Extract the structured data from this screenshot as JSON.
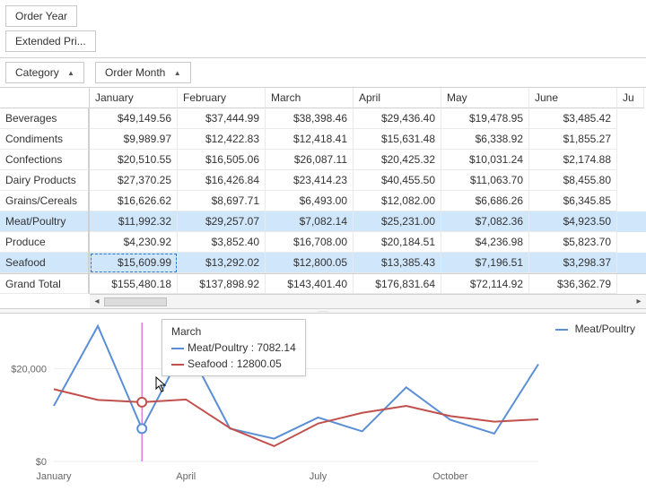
{
  "fields": {
    "order_year": "Order Year",
    "extended_price": "Extended Pri...",
    "category": "Category",
    "order_month": "Order Month"
  },
  "columns": [
    "January",
    "February",
    "March",
    "April",
    "May",
    "June",
    "Ju"
  ],
  "rows": [
    "Beverages",
    "Condiments",
    "Confections",
    "Dairy Products",
    "Grains/Cereals",
    "Meat/Poultry",
    "Produce",
    "Seafood"
  ],
  "grand_total_label": "Grand Total",
  "data": [
    [
      "$49,149.56",
      "$37,444.99",
      "$38,398.46",
      "$29,436.40",
      "$19,478.95",
      "$3,485.42"
    ],
    [
      "$9,989.97",
      "$12,422.83",
      "$12,418.41",
      "$15,631.48",
      "$6,338.92",
      "$1,855.27"
    ],
    [
      "$20,510.55",
      "$16,505.06",
      "$26,087.11",
      "$20,425.32",
      "$10,031.24",
      "$2,174.88"
    ],
    [
      "$27,370.25",
      "$16,426.84",
      "$23,414.23",
      "$40,455.50",
      "$11,063.70",
      "$8,455.80"
    ],
    [
      "$16,626.62",
      "$8,697.71",
      "$6,493.00",
      "$12,082.00",
      "$6,686.26",
      "$6,345.85"
    ],
    [
      "$11,992.32",
      "$29,257.07",
      "$7,082.14",
      "$25,231.00",
      "$7,082.36",
      "$4,923.50"
    ],
    [
      "$4,230.92",
      "$3,852.40",
      "$16,708.00",
      "$20,184.51",
      "$4,236.98",
      "$5,823.70"
    ],
    [
      "$15,609.99",
      "$13,292.02",
      "$12,800.05",
      "$13,385.43",
      "$7,196.51",
      "$3,298.37"
    ]
  ],
  "grand_total": [
    "$155,480.18",
    "$137,898.92",
    "$143,401.40",
    "$176,831.64",
    "$72,114.92",
    "$36,362.79"
  ],
  "selected_rows": [
    5,
    7
  ],
  "focused_cell": {
    "row": 7,
    "col": 0
  },
  "chart_data": {
    "type": "line",
    "x": [
      "January",
      "February",
      "March",
      "April",
      "May",
      "June",
      "July",
      "August",
      "September",
      "October",
      "November",
      "December"
    ],
    "x_ticks_shown": [
      "January",
      "April",
      "July",
      "October"
    ],
    "ylabel": "",
    "ylim": [
      0,
      30000
    ],
    "y_ticks": [
      0,
      20000
    ],
    "series": [
      {
        "name": "Meat/Poultry",
        "color": "#5a8fd6",
        "values": [
          11992.32,
          29257.07,
          7082.14,
          25231.0,
          7082.36,
          4923.5,
          9500,
          6500,
          16000,
          9000,
          6000,
          21000
        ]
      },
      {
        "name": "Seafood",
        "color": "#c0504d",
        "values": [
          15609.99,
          13292.02,
          12800.05,
          13385.43,
          7196.51,
          3298.37,
          8200,
          10500,
          12000,
          9800,
          8600,
          9100
        ]
      }
    ],
    "crosshair_x": "March",
    "tooltip": {
      "title": "March",
      "items": [
        {
          "label": "Meat/Poultry",
          "value": "7082.14",
          "color": "#5a8fd6"
        },
        {
          "label": "Seafood",
          "value": "12800.05",
          "color": "#c0504d"
        }
      ]
    }
  },
  "legend_label": "Meat/Poultry"
}
